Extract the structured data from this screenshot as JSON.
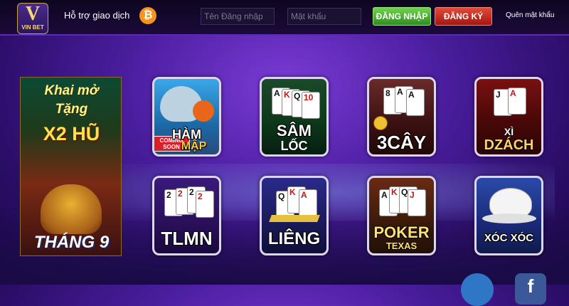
{
  "header": {
    "logo_letter": "V",
    "logo_brand": "VIN BET",
    "support_label": "Hỗ trợ giao dịch",
    "bitcoin_symbol": "₿",
    "username_placeholder": "Tên Đăng nhập",
    "password_placeholder": "Mật khẩu",
    "login_label": "ĐĂNG NHẬP",
    "register_label": "ĐĂNG KÝ",
    "forgot_label": "Quên mật khẩu"
  },
  "promo": {
    "line1": "Khai mở",
    "line2": "Tặng",
    "line3": "X2 HŨ",
    "line4": "THÁNG 9"
  },
  "games": [
    {
      "title": "HÀM",
      "title2": "MẬP",
      "badge": "COMING SOON",
      "icon": "shark-icon"
    },
    {
      "title": "SÂM",
      "title2": "LỐC",
      "icon": "cards-icon"
    },
    {
      "title": "3CÂY",
      "icon": "cards-icon"
    },
    {
      "title": "XÌ",
      "title2": "DZÁCH",
      "icon": "cards-icon"
    },
    {
      "title": "TLMN",
      "icon": "cards-icon"
    },
    {
      "title": "LIÊNG",
      "icon": "cards-icon"
    },
    {
      "title": "POKER",
      "title2": "TEXAS",
      "icon": "cards-icon"
    },
    {
      "title": "XÓC XÓC",
      "icon": "bowl-icon"
    }
  ],
  "colors": {
    "login_green": "#3aa82a",
    "register_red": "#c0221a",
    "bitcoin_orange": "#f7931a",
    "background_purple": "#4a1d9e"
  }
}
